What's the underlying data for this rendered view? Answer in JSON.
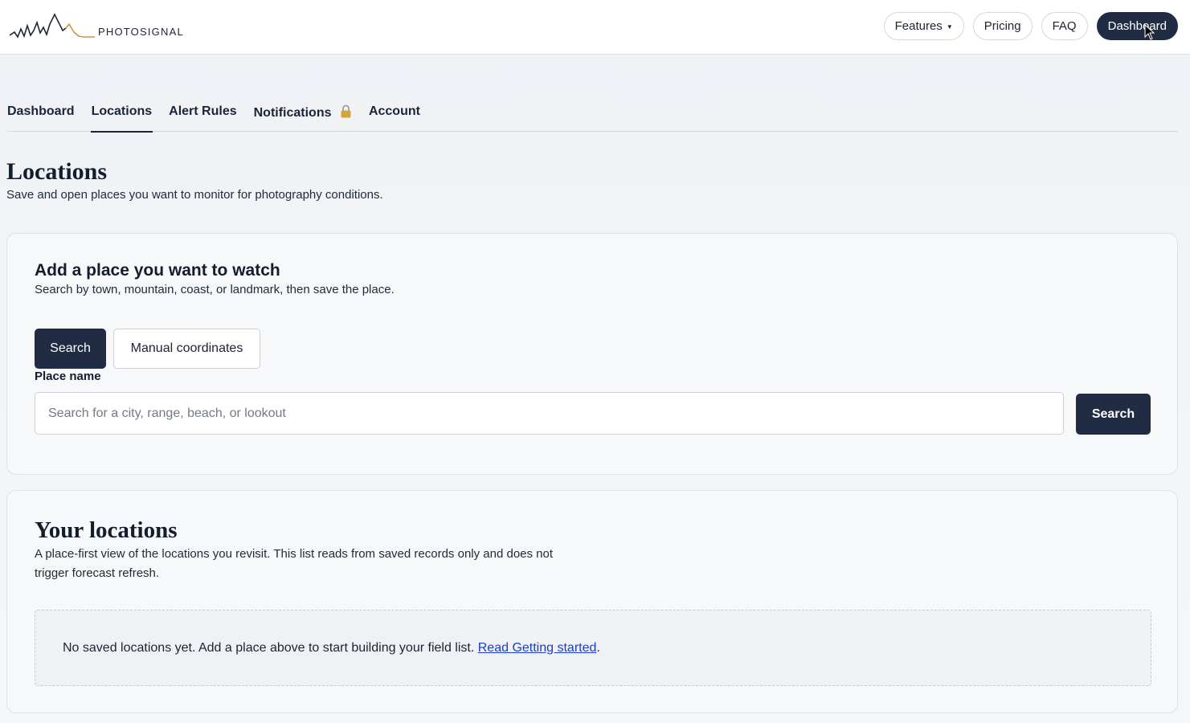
{
  "brand": {
    "name": "PHOTOSIGNAL",
    "logo_icon": "waveform-mountain-logo",
    "accent": "#c9963c"
  },
  "topnav": {
    "features_label": "Features",
    "pricing_label": "Pricing",
    "faq_label": "FAQ",
    "dashboard_label": "Dashboard"
  },
  "tabs": [
    {
      "label": "Dashboard",
      "active": false
    },
    {
      "label": "Locations",
      "active": true
    },
    {
      "label": "Alert Rules",
      "active": false
    },
    {
      "label": "Notifications",
      "active": false,
      "icon": "lock-icon"
    },
    {
      "label": "Account",
      "active": false
    }
  ],
  "page": {
    "title": "Locations",
    "subtitle": "Save and open places you want to monitor for photography conditions."
  },
  "add_place": {
    "heading": "Add a place you want to watch",
    "subtitle": "Search by town, mountain, coast, or landmark, then save the place.",
    "mode_search_label": "Search",
    "mode_manual_label": "Manual coordinates",
    "field_label": "Place name",
    "input_placeholder": "Search for a city, range, beach, or lookout",
    "input_value": "",
    "search_button_label": "Search"
  },
  "your_locations": {
    "heading": "Your locations",
    "description": "A place-first view of the locations you revisit. This list reads from saved records only and does not trigger forecast refresh.",
    "empty_text": "No saved locations yet. Add a place above to start building your field list.",
    "empty_link": "Read Getting started",
    "empty_suffix": "."
  },
  "colors": {
    "primary": "#1f2c44",
    "link": "#1a3fc2",
    "background": "#f2f4f7"
  }
}
